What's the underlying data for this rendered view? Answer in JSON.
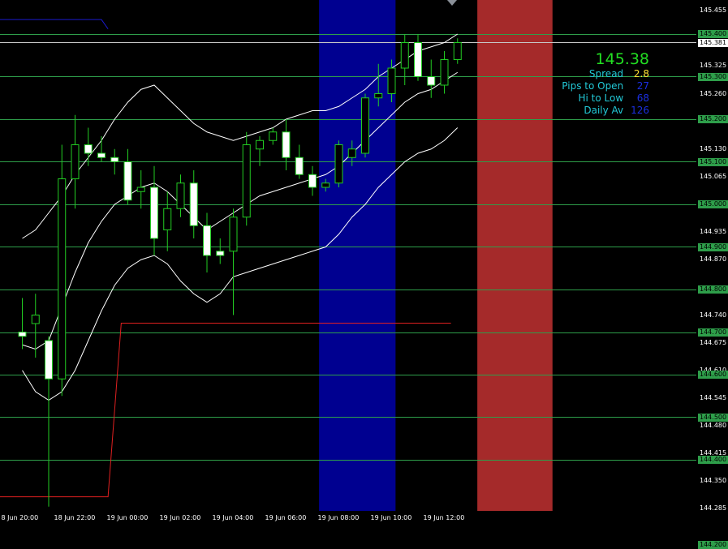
{
  "price_axis": {
    "ticks": [
      "145.455",
      "145.325",
      "145.260",
      "145.130",
      "145.065",
      "144.935",
      "144.870",
      "144.740",
      "144.675",
      "144.610",
      "144.545",
      "144.480",
      "144.415",
      "144.350",
      "144.285"
    ],
    "levels": [
      "145.400",
      "145.300",
      "145.200",
      "145.100",
      "145.000",
      "144.900",
      "144.800",
      "144.700",
      "144.600",
      "144.500",
      "144.400",
      "144.200"
    ],
    "current_price": "145.381"
  },
  "time_axis": {
    "labels": [
      "8 Jun 20:00",
      "18 Jun 22:00",
      "19 Jun 00:00",
      "19 Jun 02:00",
      "19 Jun 04:00",
      "19 Jun 06:00",
      "19 Jun 08:00",
      "19 Jun 10:00",
      "19 Jun 12:00"
    ]
  },
  "info_panel": {
    "price": "145.38",
    "rows": [
      {
        "label": "Spread",
        "value": "2.8",
        "color": "#ffe135"
      },
      {
        "label": "Pips to Open",
        "value": "27",
        "color": "#1b2fe0"
      },
      {
        "label": "Hi to Low",
        "value": "68",
        "color": "#1b2fe0"
      },
      {
        "label": "Daily Av",
        "value": "126",
        "color": "#1b2fe0"
      }
    ]
  },
  "colors": {
    "background": "#000000",
    "candle_wick": "#22cc22",
    "candle_bull": "#000000",
    "candle_bear": "#ffffff",
    "grid_level": "#2e9e4a",
    "session_blue": "#000090",
    "session_red": "#a52a2a",
    "band": "#ffffff",
    "red_line": "#e02020",
    "blue_line": "#1a1acc"
  },
  "chart_data": {
    "type": "candlestick",
    "y_range": [
      144.28,
      145.48
    ],
    "candles": [
      {
        "o": 144.7,
        "h": 144.78,
        "l": 144.66,
        "c": 144.69
      },
      {
        "o": 144.72,
        "h": 144.79,
        "l": 144.64,
        "c": 144.74
      },
      {
        "o": 144.68,
        "h": 144.69,
        "l": 144.29,
        "c": 144.59
      },
      {
        "o": 144.59,
        "h": 145.14,
        "l": 144.55,
        "c": 145.06
      },
      {
        "o": 145.06,
        "h": 145.21,
        "l": 144.99,
        "c": 145.14
      },
      {
        "o": 145.14,
        "h": 145.18,
        "l": 145.09,
        "c": 145.12
      },
      {
        "o": 145.12,
        "h": 145.16,
        "l": 145.1,
        "c": 145.11
      },
      {
        "o": 145.11,
        "h": 145.13,
        "l": 145.07,
        "c": 145.1
      },
      {
        "o": 145.1,
        "h": 145.13,
        "l": 145.0,
        "c": 145.01
      },
      {
        "o": 145.03,
        "h": 145.08,
        "l": 144.99,
        "c": 145.04
      },
      {
        "o": 145.04,
        "h": 145.09,
        "l": 144.88,
        "c": 144.92
      },
      {
        "o": 144.94,
        "h": 145.03,
        "l": 144.89,
        "c": 144.99
      },
      {
        "o": 144.99,
        "h": 145.07,
        "l": 144.97,
        "c": 145.05
      },
      {
        "o": 145.05,
        "h": 145.08,
        "l": 144.92,
        "c": 144.95
      },
      {
        "o": 144.95,
        "h": 144.98,
        "l": 144.84,
        "c": 144.88
      },
      {
        "o": 144.89,
        "h": 144.92,
        "l": 144.86,
        "c": 144.88
      },
      {
        "o": 144.89,
        "h": 144.99,
        "l": 144.74,
        "c": 144.97
      },
      {
        "o": 144.97,
        "h": 145.17,
        "l": 144.95,
        "c": 145.14
      },
      {
        "o": 145.13,
        "h": 145.16,
        "l": 145.09,
        "c": 145.15
      },
      {
        "o": 145.15,
        "h": 145.18,
        "l": 145.14,
        "c": 145.17
      },
      {
        "o": 145.17,
        "h": 145.2,
        "l": 145.08,
        "c": 145.11
      },
      {
        "o": 145.11,
        "h": 145.14,
        "l": 145.06,
        "c": 145.07
      },
      {
        "o": 145.07,
        "h": 145.09,
        "l": 145.02,
        "c": 145.04
      },
      {
        "o": 145.04,
        "h": 145.06,
        "l": 145.03,
        "c": 145.05
      },
      {
        "o": 145.05,
        "h": 145.15,
        "l": 145.04,
        "c": 145.14
      },
      {
        "o": 145.11,
        "h": 145.15,
        "l": 145.09,
        "c": 145.13
      },
      {
        "o": 145.12,
        "h": 145.26,
        "l": 145.11,
        "c": 145.25
      },
      {
        "o": 145.25,
        "h": 145.33,
        "l": 145.23,
        "c": 145.26
      },
      {
        "o": 145.26,
        "h": 145.34,
        "l": 145.24,
        "c": 145.32
      },
      {
        "o": 145.32,
        "h": 145.4,
        "l": 145.28,
        "c": 145.38
      },
      {
        "o": 145.38,
        "h": 145.4,
        "l": 145.29,
        "c": 145.3
      },
      {
        "o": 145.3,
        "h": 145.34,
        "l": 145.25,
        "c": 145.28
      },
      {
        "o": 145.28,
        "h": 145.36,
        "l": 145.26,
        "c": 145.34
      },
      {
        "o": 145.34,
        "h": 145.39,
        "l": 145.33,
        "c": 145.38
      }
    ],
    "upper_band": [
      144.92,
      144.94,
      144.98,
      145.02,
      145.07,
      145.11,
      145.15,
      145.2,
      145.24,
      145.27,
      145.28,
      145.25,
      145.22,
      145.19,
      145.17,
      145.16,
      145.15,
      145.16,
      145.17,
      145.18,
      145.2,
      145.21,
      145.22,
      145.22,
      145.23,
      145.25,
      145.27,
      145.3,
      145.32,
      145.34,
      145.36,
      145.37,
      145.38,
      145.4
    ],
    "middle_band": [
      144.67,
      144.66,
      144.68,
      144.76,
      144.84,
      144.91,
      144.96,
      145.0,
      145.02,
      145.04,
      145.05,
      145.03,
      145.0,
      144.97,
      144.94,
      144.96,
      144.98,
      145.0,
      145.02,
      145.03,
      145.04,
      145.05,
      145.06,
      145.07,
      145.09,
      145.12,
      145.15,
      145.18,
      145.21,
      145.24,
      145.26,
      145.27,
      145.29,
      145.31
    ],
    "lower_band": [
      144.61,
      144.56,
      144.54,
      144.56,
      144.61,
      144.68,
      144.75,
      144.81,
      144.85,
      144.87,
      144.88,
      144.86,
      144.82,
      144.79,
      144.77,
      144.79,
      144.83,
      144.84,
      144.85,
      144.86,
      144.87,
      144.88,
      144.89,
      144.9,
      144.93,
      144.97,
      145.0,
      145.04,
      145.07,
      145.1,
      145.12,
      145.13,
      145.15,
      145.18
    ],
    "red_line": [
      {
        "i": -4,
        "y": 144.313
      },
      {
        "i": 6.5,
        "y": 144.313
      },
      {
        "i": 7.5,
        "y": 144.721
      },
      {
        "i": 32.5,
        "y": 144.721
      }
    ],
    "blue_line": [
      {
        "i": -4,
        "y": 145.434
      },
      {
        "i": 6,
        "y": 145.434
      },
      {
        "i": 6.5,
        "y": 145.412
      }
    ],
    "sessions": [
      {
        "from": 22.5,
        "to": 28.3,
        "color": "#000090"
      },
      {
        "from": 34.5,
        "to": 40.2,
        "color": "#a52a2a"
      }
    ]
  }
}
